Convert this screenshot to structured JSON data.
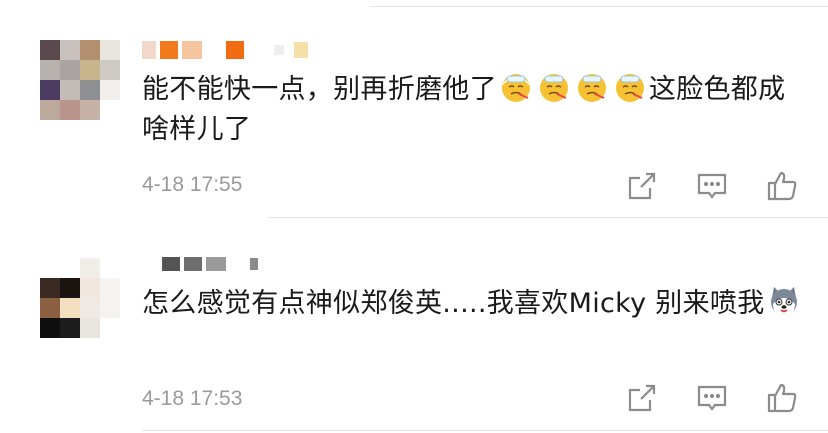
{
  "comments": [
    {
      "username_hidden": true,
      "text_before_emoji": "能不能快一点，别再折磨他了",
      "emoji_count": 4,
      "emoji_name": "sick-face-emoji",
      "text_after_emoji": "这脸色都成啥样儿了",
      "time": "4-18 17:55"
    },
    {
      "username_hidden": true,
      "text_before_emoji": "怎么感觉有点神似郑俊英.....我喜欢Micky 别来喷我",
      "emoji_count": 1,
      "emoji_name": "husky-dog-emoji",
      "text_after_emoji": "",
      "time": "4-18 17:53"
    }
  ],
  "action_icons": [
    "share-icon",
    "comment-icon",
    "like-icon"
  ],
  "colors": {
    "text": "#1a1a1a",
    "time": "#9a9a9a",
    "icon": "#8c8c8c",
    "divider": "#e6e6e6"
  }
}
